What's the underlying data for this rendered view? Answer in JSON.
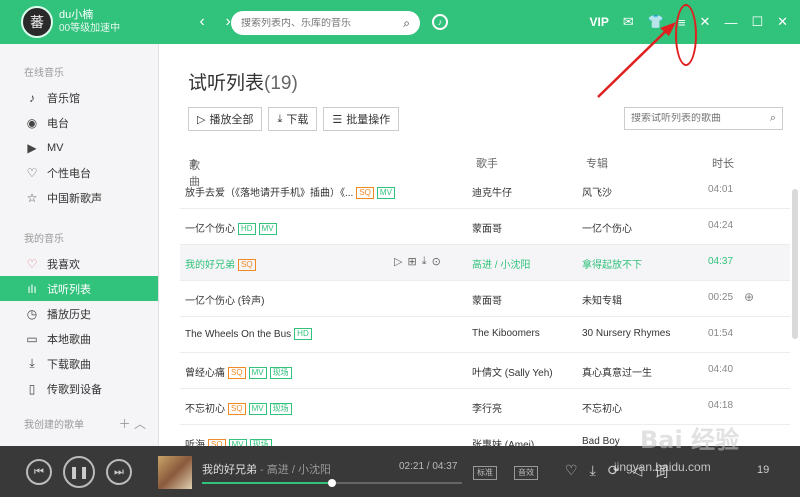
{
  "user": {
    "avatar_char": "蕃",
    "name": "du小楠",
    "level": "00等级加速中"
  },
  "search": {
    "placeholder": "搜索列表内、乐库的音乐"
  },
  "topbar": {
    "vip": "VIP"
  },
  "sidebar": {
    "online_group": "在线音乐",
    "online_items": [
      {
        "label": "音乐馆",
        "icon": "music-hall-icon",
        "glyph": "♪"
      },
      {
        "label": "电台",
        "icon": "radio-icon",
        "glyph": "◉"
      },
      {
        "label": "MV",
        "icon": "mv-icon",
        "glyph": "▶"
      },
      {
        "label": "个性电台",
        "icon": "heart-radio-icon",
        "glyph": "♡"
      },
      {
        "label": "中国新歌声",
        "icon": "star-icon",
        "glyph": "☆"
      }
    ],
    "my_group": "我的音乐",
    "my_items": [
      {
        "label": "我喜欢",
        "icon": "heart-icon",
        "glyph": "♡"
      },
      {
        "label": "试听列表",
        "icon": "bars-icon",
        "glyph": "ılı",
        "active": true
      },
      {
        "label": "播放历史",
        "icon": "clock-icon",
        "glyph": "◷"
      },
      {
        "label": "本地歌曲",
        "icon": "monitor-icon",
        "glyph": "▭"
      },
      {
        "label": "下载歌曲",
        "icon": "download-icon",
        "glyph": "⤓"
      },
      {
        "label": "传歌到设备",
        "icon": "device-icon",
        "glyph": "▯"
      }
    ],
    "created_group": "我创建的歌单"
  },
  "main": {
    "title": "试听列表",
    "count": "(19)",
    "actions": {
      "play_all": "播放全部",
      "download": "下载",
      "batch": "批量操作"
    },
    "list_search_placeholder": "搜索试听列表的歌曲",
    "columns": {
      "song": "歌曲",
      "artist": "歌手",
      "album": "专辑",
      "duration": "时长"
    }
  },
  "songs": [
    {
      "title": "放手去爱（《落地请开手机》插曲）《...",
      "badges": [
        "SQ",
        "MV"
      ],
      "artist": "迪克牛仔",
      "album": "风飞沙",
      "duration": "04:01"
    },
    {
      "title": "一亿个伤心",
      "badges": [
        "HD",
        "MV"
      ],
      "artist": "蒙面哥",
      "album": "一亿个伤心",
      "duration": "04:24"
    },
    {
      "title": "我的好兄弟",
      "badges": [
        "SQ"
      ],
      "artist": "高进 / 小沈阳",
      "album": "拿得起放不下",
      "duration": "04:37",
      "playing": true
    },
    {
      "title": "一亿个伤心 (铃声)",
      "badges": [],
      "artist": "蒙面哥",
      "album": "未知专辑",
      "duration": "00:25"
    },
    {
      "title": "The Wheels On the Bus",
      "badges": [
        "HD"
      ],
      "artist": "The Kiboomers",
      "album": "30 Nursery Rhymes",
      "duration": "01:54"
    },
    {
      "title": "曾经心痛",
      "badges": [
        "SQ",
        "MV",
        "现场"
      ],
      "artist": "叶倩文 (Sally Yeh)",
      "album": "真心真意过一生",
      "duration": "04:40"
    },
    {
      "title": "不忘初心",
      "badges": [
        "SQ",
        "MV",
        "现场"
      ],
      "artist": "李行亮",
      "album": "不忘初心",
      "duration": "04:18"
    },
    {
      "title": "听海",
      "badges": [
        "SQ",
        "MV",
        "现场"
      ],
      "artist": "张惠妹 (Amei)",
      "album": "Bad Boy",
      "duration": ""
    }
  ],
  "player": {
    "song": "我的好兄弟",
    "sep": " - ",
    "artist": "高进 / 小沈阳",
    "time": "02:21 / 04:37",
    "progress": 0.5,
    "tag_quality": "标准",
    "tag_effect": "音效",
    "count": "19"
  },
  "watermark": {
    "brand": "Bai 经验",
    "url": "jingyan.baidu.com"
  }
}
